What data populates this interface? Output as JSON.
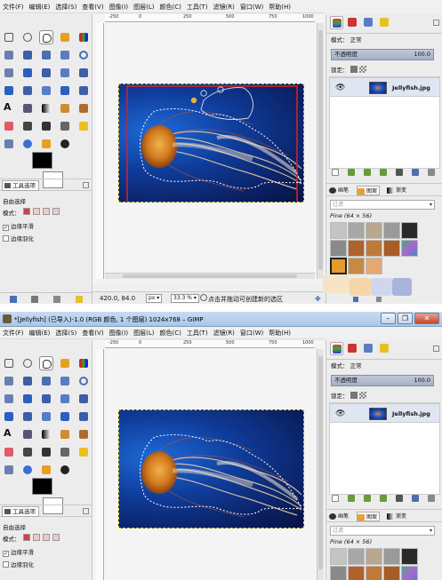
{
  "window1": {
    "menu": [
      "文件(F)",
      "编辑(E)",
      "选择(S)",
      "查看(V)",
      "图像(I)",
      "图层(L)",
      "颜色(C)",
      "工具(T)",
      "滤镜(R)",
      "窗口(W)",
      "帮助(H)"
    ],
    "ruler_labels": [
      "-250",
      "0",
      "250",
      "500",
      "750",
      "1000"
    ],
    "toolbox": {
      "tab_label": "工具选项",
      "tool_title": "自由选择",
      "mode_label": "模式：",
      "antialias_label": "边缘平滑",
      "feather_label": "边缘羽化",
      "antialias_checked": true
    },
    "status": {
      "coords": "420.0, 84.0",
      "unit": "px",
      "zoom": "33.3 %",
      "message": "点击并拖动可创建新的选区"
    },
    "layers": {
      "mode_label": "模式：",
      "mode_value": "正常",
      "opacity_label": "不透明度",
      "opacity_value": "100.0",
      "lock_label": "锁定：",
      "layer_name": "Jellyfish.jpg"
    },
    "brushes": {
      "tab_brushes": "画笔",
      "tab_patterns": "图案",
      "tab_gradients": "渐变",
      "filter_placeholder": "过滤",
      "pattern_name": "Pine (64 × 56)"
    }
  },
  "window2": {
    "title": "*[Jellyfish] (已导入)-1.0 (RGB 颜色, 1 个图层) 1024x768 – GIMP",
    "menu": [
      "文件(F)",
      "编辑(E)",
      "选择(S)",
      "查看(V)",
      "图像(I)",
      "图层(L)",
      "颜色(C)",
      "工具(T)",
      "滤镜(R)",
      "窗口(W)",
      "帮助(H)"
    ],
    "ruler_labels": [
      "-250",
      "0",
      "250",
      "500",
      "750",
      "1000"
    ],
    "toolbox": {
      "tab_label": "工具选项",
      "tool_title": "自由选择",
      "mode_label": "模式：",
      "antialias_label": "边缘平滑",
      "feather_label": "边缘羽化"
    },
    "layers": {
      "mode_label": "模式：",
      "mode_value": "正常",
      "opacity_label": "不透明度",
      "opacity_value": "100.0",
      "lock_label": "锁定：",
      "layer_name": "Jellyfish.jpg"
    },
    "brushes": {
      "tab_brushes": "画笔",
      "tab_patterns": "图案",
      "tab_gradients": "渐变",
      "filter_placeholder": "过滤",
      "pattern_name": "Pine (64 × 56)"
    }
  },
  "colors": {
    "image_blue": "#0f3c9a",
    "jellyfish_orange": "#d78a2a",
    "selection_red": "#d0202c",
    "window_bg": "#f0f0f0"
  }
}
